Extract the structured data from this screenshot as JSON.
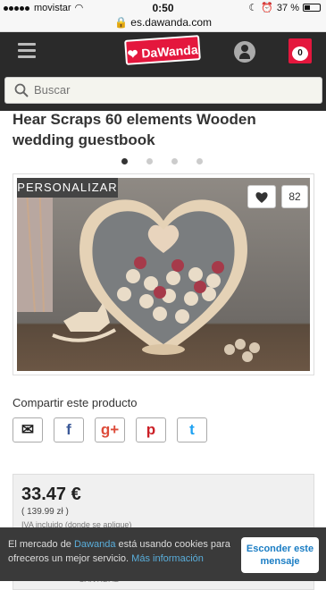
{
  "status": {
    "carrier": "movistar",
    "time": "0:50",
    "battery_percent": "37 %",
    "battery_level": 0.37
  },
  "browser": {
    "url": "es.dawanda.com"
  },
  "header": {
    "logo_text": "DaWanda",
    "cart_count": "0"
  },
  "search": {
    "placeholder": "Buscar"
  },
  "product": {
    "title": "Hear Scraps 60 elements Wooden wedding guestbook",
    "badge": "PERSONALIZAR",
    "favorites_count": "82",
    "gallery_pages": 4,
    "gallery_active": 0
  },
  "share": {
    "title": "Compartir este producto",
    "buttons": [
      {
        "name": "email",
        "glyph": "✉",
        "color": "#222222"
      },
      {
        "name": "facebook",
        "glyph": "f",
        "color": "#3b5998"
      },
      {
        "name": "googleplus",
        "glyph": "g+",
        "color": "#dd4b39"
      },
      {
        "name": "pinterest",
        "glyph": "p",
        "color": "#cb2027"
      },
      {
        "name": "twitter",
        "glyph": "t",
        "color": "#1da1f2"
      }
    ]
  },
  "price": {
    "main": "33.47 €",
    "secondary": "( 139.99 zł )",
    "tax_note": "IVA incluido (donde se aplique)"
  },
  "cookie": {
    "text_before": "El mercado de ",
    "brand": "Dawanda",
    "text_after": " está usando cookies para ofreceros un mejor servicio. ",
    "link": "Más información",
    "button": "Esconder este mensaje"
  },
  "quantity_label": "CANTIDAD",
  "colors": {
    "brand_red": "#e4173d",
    "header_dark": "#2a2a2a",
    "link_blue": "#5aaedb"
  }
}
